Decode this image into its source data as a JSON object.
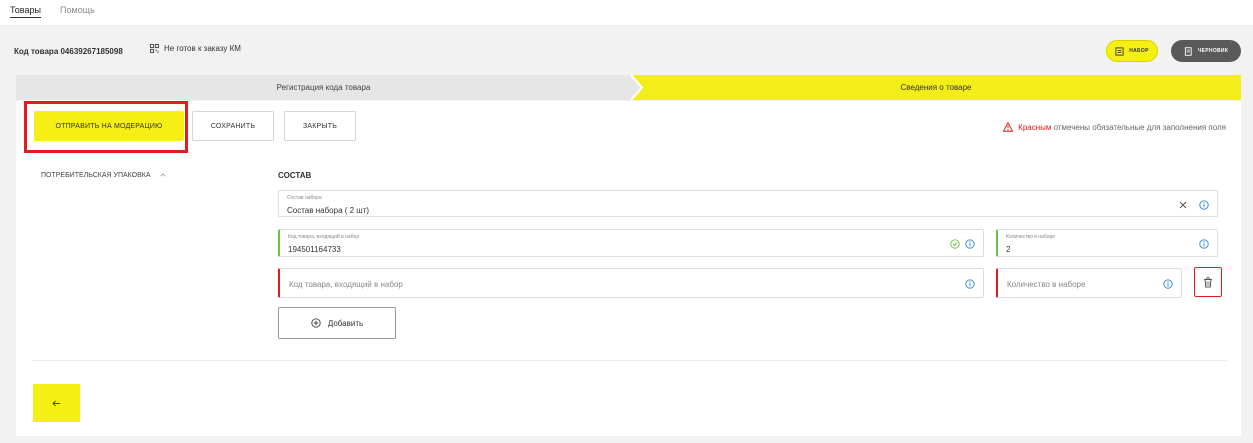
{
  "nav": {
    "tabs": [
      {
        "label": "Товары",
        "active": true
      },
      {
        "label": "Помощь",
        "active": false
      }
    ]
  },
  "header": {
    "product_code_label": "Код товара 04639267185098",
    "km_status": "Не готов к заказу КМ",
    "km_status_icon": "qr-code-icon",
    "kit_badge": {
      "label": "набор",
      "icon": "box-icon",
      "color": "#f5ef15"
    },
    "draft_badge": {
      "label": "черновик",
      "icon": "document-icon",
      "color": "#5a5a5a"
    }
  },
  "steps": [
    {
      "label": "Регистрация кода товара",
      "active": false
    },
    {
      "label": "Сведения о товаре",
      "active": true
    }
  ],
  "toolbar": {
    "submit_label": "отправить на модерацию",
    "save_label": "сохранить",
    "close_label": "закрыть"
  },
  "required_note": {
    "highlight": "Красным",
    "text": " отмечены обязательные для заполнения поля",
    "icon": "warning-icon",
    "color": "#e31b1b"
  },
  "sidebar": {
    "section_label": "потребительская упаковка",
    "expanded": true
  },
  "composition": {
    "title": "СОСТАВ",
    "kit_field": {
      "label": "Состав набора",
      "value": "Состав набора ( 2 шт)"
    },
    "rows": [
      {
        "code_label": "Код товара, входящий в набор",
        "code_value": "194501164733",
        "qty_label": "Количество в наборе",
        "qty_value": "2",
        "status": "valid"
      },
      {
        "code_placeholder": "Код товара, входящий в набор",
        "qty_placeholder": "Количество в наборе",
        "status": "error"
      }
    ],
    "add_label": "Добавить"
  },
  "colors": {
    "accent_yellow": "#f5ef15",
    "error_red": "#e31b1b",
    "valid_green": "#6cc24a",
    "info_blue": "#2f86d6"
  }
}
